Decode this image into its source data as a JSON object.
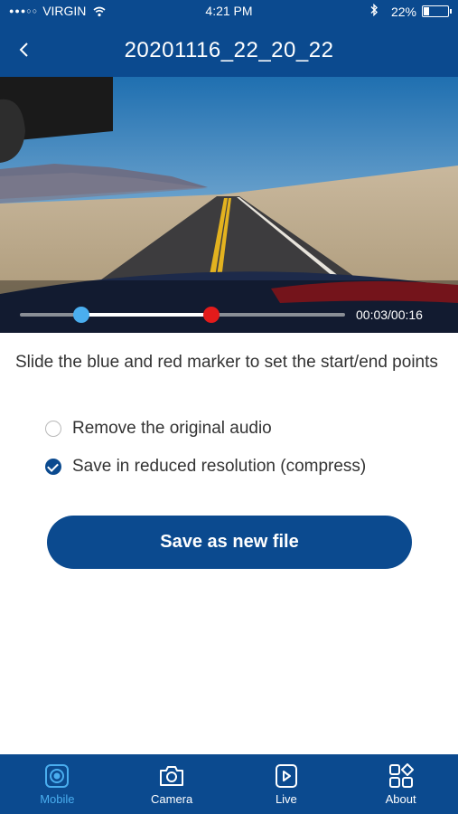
{
  "status_bar": {
    "signal": "●●●○○",
    "carrier": "VIRGIN",
    "time": "4:21 PM",
    "battery": "22%",
    "battery_level": 0.22,
    "icons": [
      "wifi-icon",
      "bluetooth-icon",
      "battery-icon"
    ]
  },
  "nav": {
    "title": "20201116_22_20_22",
    "back_icon": "chevron-left-icon"
  },
  "video": {
    "time_readout": "00:03/00:16",
    "start_fraction": 0.19,
    "end_fraction": 0.59
  },
  "editor": {
    "instructions": "Slide the blue and red marker to set the start/end points",
    "options": [
      {
        "label": "Remove the original audio",
        "checked": false
      },
      {
        "label": "Save in reduced resolution (compress)",
        "checked": true
      }
    ],
    "save_label": "Save as new file"
  },
  "tabs": [
    {
      "label": "Mobile",
      "icon": "mobile-icon",
      "active": true
    },
    {
      "label": "Camera",
      "icon": "camera-icon",
      "active": false
    },
    {
      "label": "Live",
      "icon": "play-icon",
      "active": false
    },
    {
      "label": "About",
      "icon": "grid-icon",
      "active": false
    }
  ],
  "colors": {
    "primary": "#0b4a8f",
    "accent": "#4aaeef",
    "end_marker": "#e31b1b"
  }
}
